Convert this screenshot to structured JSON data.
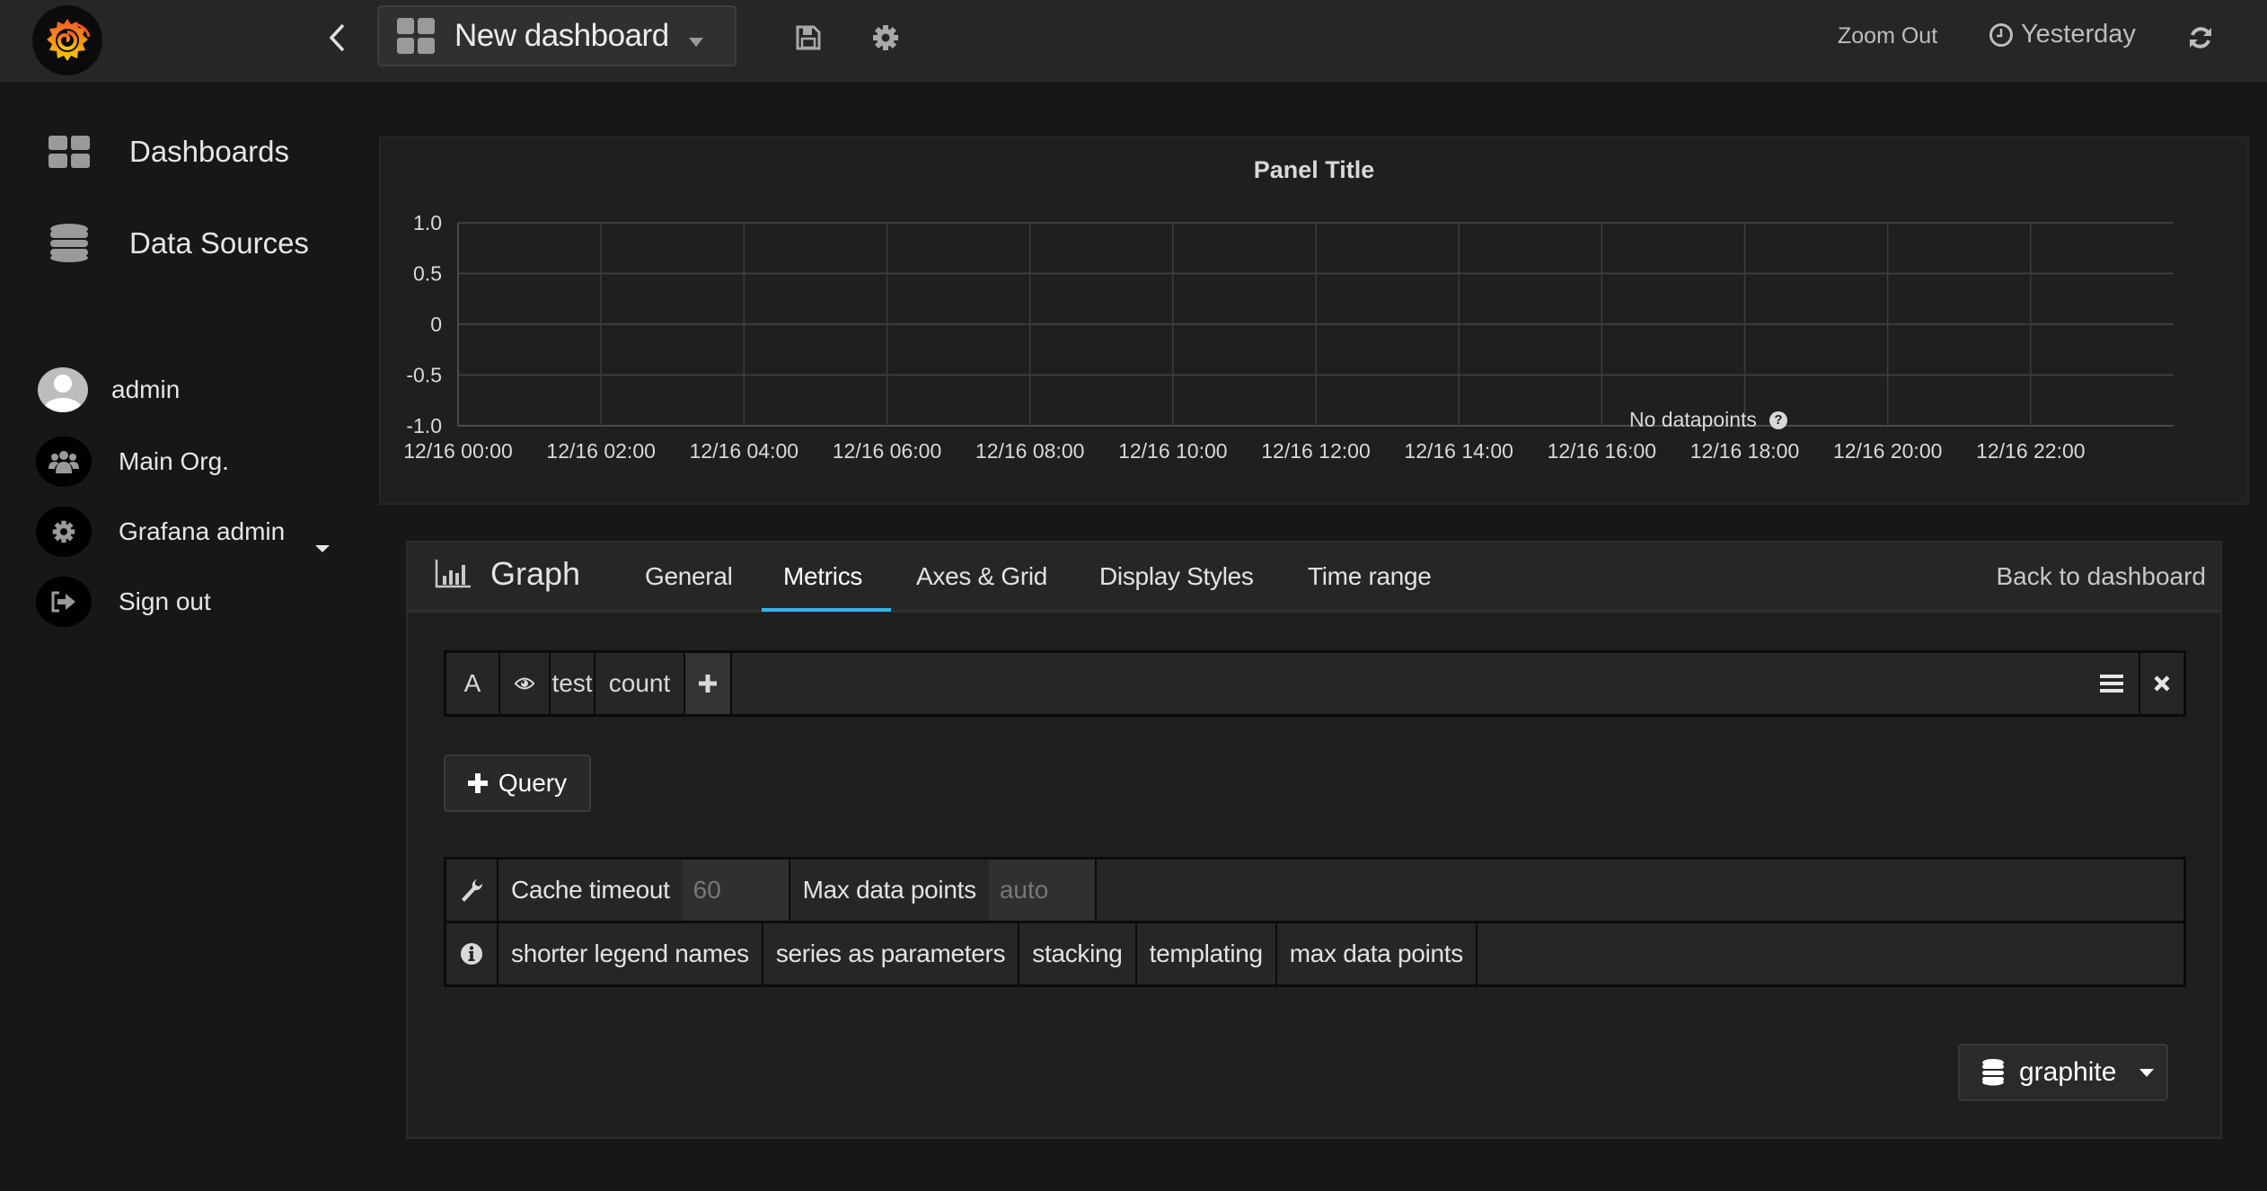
{
  "navbar": {
    "logo_icon": "grafana-logo-icon",
    "back_icon": "chevron-left-icon",
    "dashboard_title": "New dashboard",
    "dashboard_icon": "dashboard-grid-icon",
    "save_icon": "floppy-disk-icon",
    "settings_icon": "gear-icon",
    "zoom_out_label": "Zoom Out",
    "time_range_label": "Yesterday",
    "time_icon": "clock-icon",
    "refresh_icon": "refresh-icon"
  },
  "sidebar": {
    "main_items": [
      {
        "label": "Dashboards",
        "icon": "dashboard-grid-icon"
      },
      {
        "label": "Data Sources",
        "icon": "database-icon"
      }
    ],
    "user_items": [
      {
        "label": "admin",
        "icon": "avatar-icon"
      },
      {
        "label": "Main Org.",
        "icon": "users-icon"
      },
      {
        "label": "Grafana admin",
        "icon": "gear-icon"
      },
      {
        "label": "Sign out",
        "icon": "sign-out-icon"
      }
    ]
  },
  "graph_panel": {
    "title": "Panel Title",
    "no_data_message": "No datapoints",
    "help_icon": "question-circle-icon"
  },
  "chart_data": {
    "type": "line",
    "title": "Panel Title",
    "xlabel": "",
    "ylabel": "",
    "series": [],
    "x_tick_labels": [
      "12/16 00:00",
      "12/16 02:00",
      "12/16 04:00",
      "12/16 06:00",
      "12/16 08:00",
      "12/16 10:00",
      "12/16 12:00",
      "12/16 14:00",
      "12/16 16:00",
      "12/16 18:00",
      "12/16 20:00",
      "12/16 22:00"
    ],
    "x_range_hours": [
      0,
      24
    ],
    "x_tick_hours": [
      0,
      2,
      4,
      6,
      8,
      10,
      12,
      14,
      16,
      18,
      20,
      22
    ],
    "y_tick_labels": [
      "1.0",
      "0.5",
      "0",
      "-0.5",
      "-1.0"
    ],
    "y_ticks": [
      1.0,
      0.5,
      0,
      -0.5,
      -1.0
    ],
    "ylim": [
      -1.0,
      1.0
    ],
    "grid": true,
    "annotation": "No datapoints"
  },
  "editor": {
    "panel_type_icon": "bar-chart-icon",
    "panel_type_label": "Graph",
    "tabs": [
      {
        "label": "General",
        "active": false
      },
      {
        "label": "Metrics",
        "active": true
      },
      {
        "label": "Axes & Grid",
        "active": false
      },
      {
        "label": "Display Styles",
        "active": false
      },
      {
        "label": "Time range",
        "active": false
      }
    ],
    "back_to_dashboard_label": "Back to dashboard",
    "accent_color": "#33b5e5",
    "query": {
      "ref_id": "A",
      "visibility_icon": "eye-icon",
      "segments": [
        "test",
        "count"
      ],
      "add_segment_icon": "plus-icon",
      "menu_icon": "hamburger-icon",
      "remove_icon": "close-icon"
    },
    "add_query_label": "Query",
    "options_row1": {
      "icon": "wrench-icon",
      "cache_timeout_label": "Cache timeout",
      "cache_timeout_placeholder": "60",
      "max_data_points_label": "Max data points",
      "max_data_points_placeholder": "auto"
    },
    "options_row2": {
      "icon": "info-circle-icon",
      "links": [
        "shorter legend names",
        "series as parameters",
        "stacking",
        "templating",
        "max data points"
      ]
    },
    "datasource": {
      "icon": "database-icon",
      "label": "graphite"
    }
  }
}
